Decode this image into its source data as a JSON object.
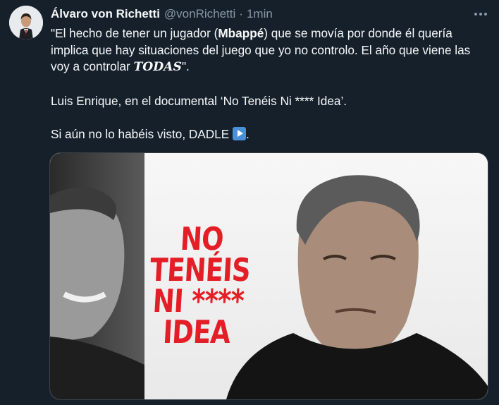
{
  "tweet": {
    "author_name": "Álvaro von Richetti",
    "handle": "@vonRichetti",
    "separator": "·",
    "time": "1min",
    "more_icon": "more-horizontal-icon",
    "body": {
      "line1_a": "\"El hecho de tener un jugador (",
      "line1_bold": "Mbappé",
      "line1_b": ") que se movía por donde él quería implica que hay situaciones del juego que yo no controlo. El año que viene las voy a controlar ",
      "line1_italic": "TODAS",
      "line1_c": "\".",
      "line2": "Luis Enrique, en el documental ‘No Tenéis Ni **** Idea’.",
      "line3_a": "Si aún no lo habéis visto, DADLE ",
      "line3_emoji": "play-button-emoji",
      "line3_b": "."
    },
    "media": {
      "poster_title_line1": "NO TENÉIS",
      "poster_title_line2": "NI **** IDEA",
      "accent_color": "#e41e26"
    }
  },
  "colors": {
    "background": "#15202b",
    "text_primary": "#f7f9f9",
    "text_secondary": "#8b98a5"
  }
}
